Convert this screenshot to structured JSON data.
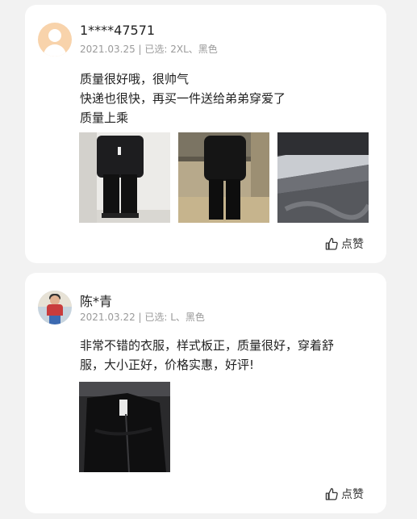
{
  "reviews": [
    {
      "username": "1****47571",
      "meta": "2021.03.25 | 已选: 2XL、黑色",
      "lines": [
        "质量很好哦，很帅气",
        "快递也很快，再买一件送给弟弟穿爱了",
        "质量上乘"
      ],
      "like_label": "点赞"
    },
    {
      "username": "陈*青",
      "meta": "2021.03.22 | 已选: L、黑色",
      "lines": [
        "非常不错的衣服，样式板正，质量很好，穿着舒",
        "服，大小正好，价格实惠，好评!"
      ],
      "like_label": "点赞"
    }
  ],
  "icons": {
    "like": "thumbs-up-icon",
    "avatar1": "default-user-avatar",
    "avatar2": "user-photo-avatar"
  }
}
